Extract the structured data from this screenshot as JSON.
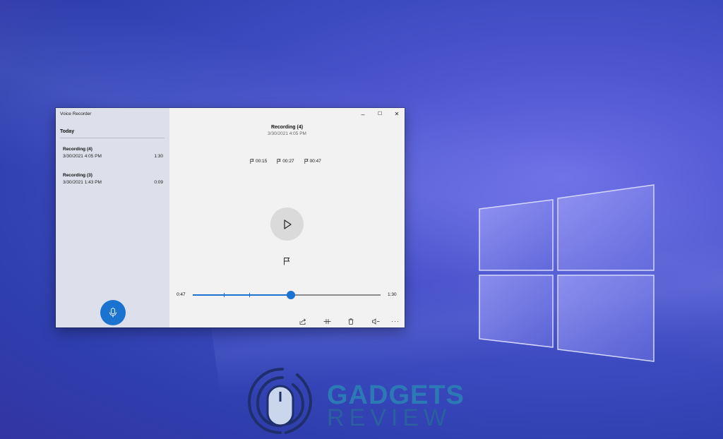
{
  "window": {
    "title": "Voice Recorder",
    "controls": {
      "minimize": "–",
      "maximize": "☐",
      "close": "✕"
    }
  },
  "sidebar": {
    "section": "Today",
    "recordings": [
      {
        "name": "Recording (4)",
        "date": "3/30/2021 4:05 PM",
        "duration": "1:30"
      },
      {
        "name": "Recording (3)",
        "date": "3/30/2021 1:43 PM",
        "duration": "0:09"
      }
    ],
    "record_button_icon": "microphone-icon"
  },
  "player": {
    "title": "Recording (4)",
    "date": "3/30/2021 4:05 PM",
    "markers": [
      "00:15",
      "00:27",
      "00:47"
    ],
    "current_time": "0:47",
    "total_time": "1:30",
    "progress_fraction": 0.522,
    "marker_fractions": [
      0.167,
      0.3,
      0.522
    ],
    "toolbar_icons": [
      "share-icon",
      "trim-icon",
      "delete-icon",
      "volume-icon",
      "more-icon"
    ]
  },
  "watermark": {
    "line1": "GADGETS",
    "line2": "REVIEW"
  },
  "colors": {
    "accent": "#1a73d0",
    "sidebar": "#dde0ea",
    "content": "#f2f2f2"
  }
}
